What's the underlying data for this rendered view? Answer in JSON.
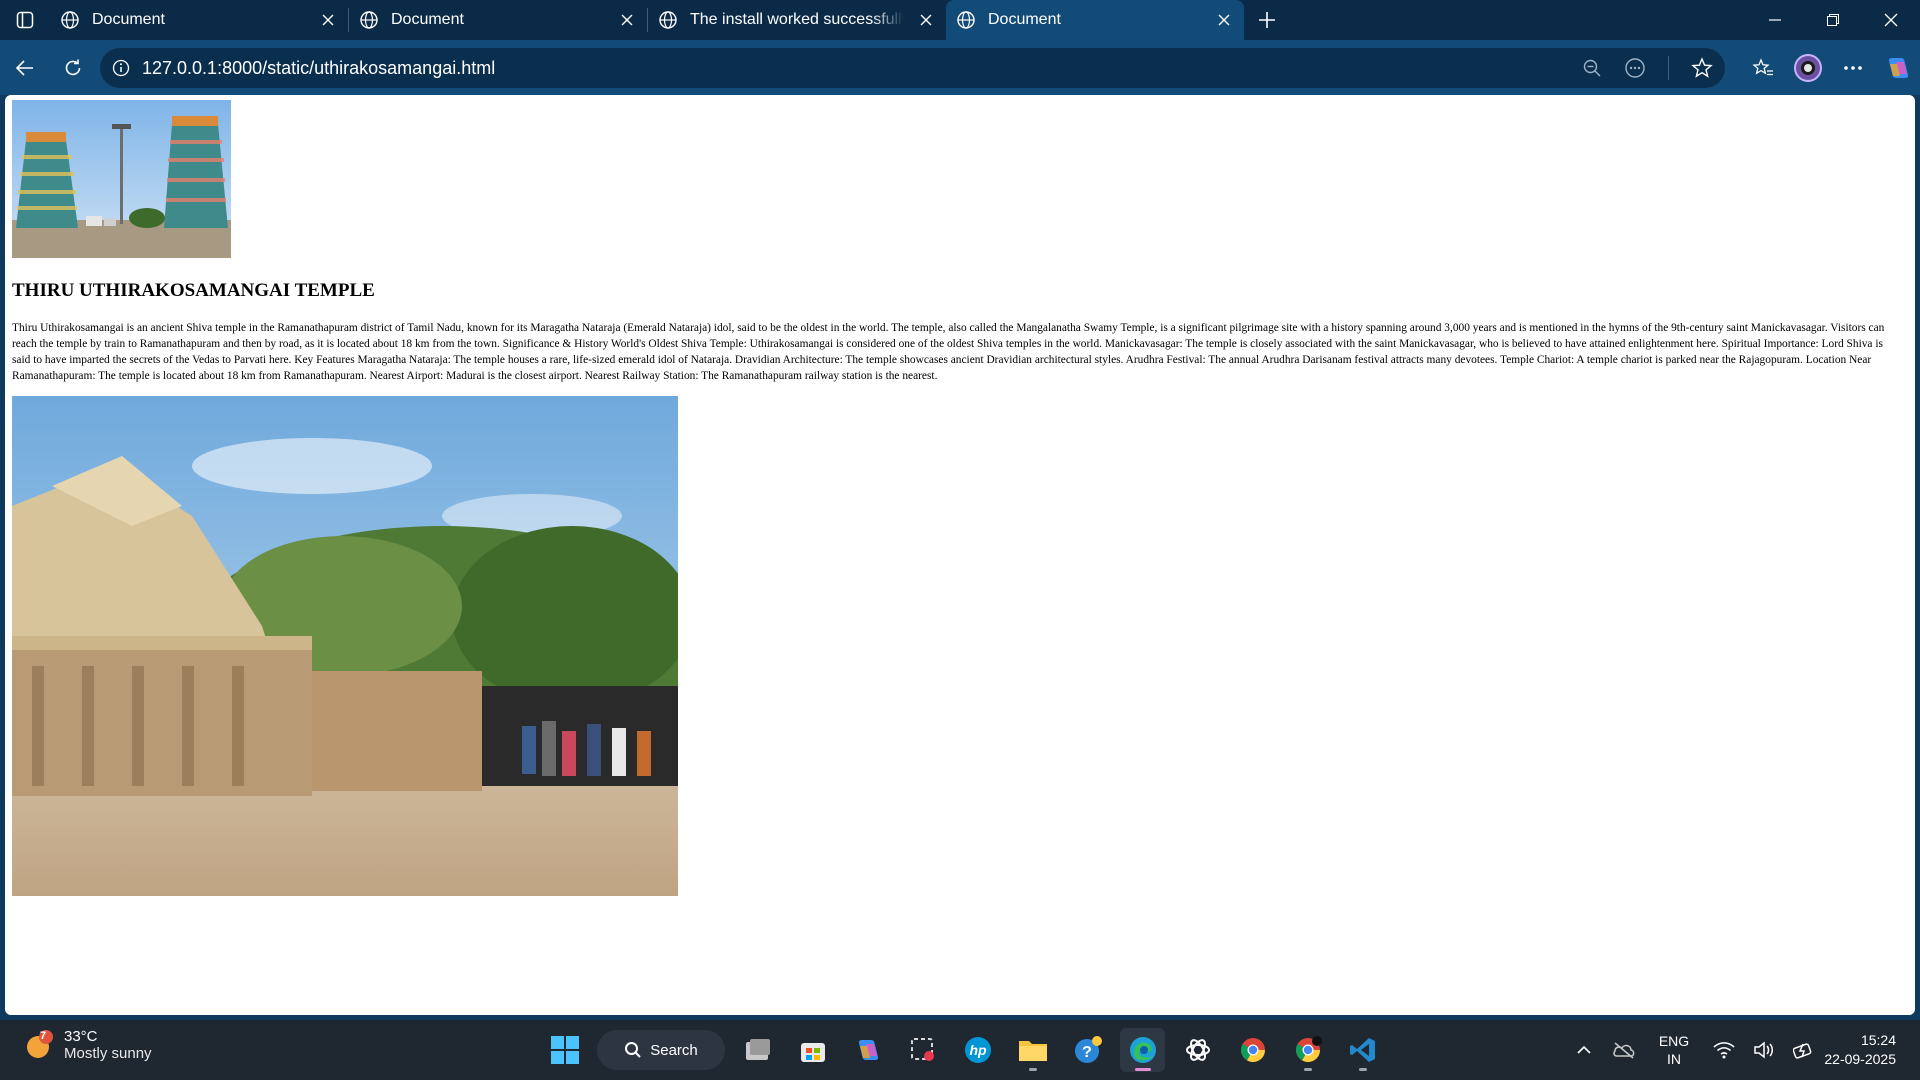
{
  "browser": {
    "tabs": [
      {
        "title": "Document",
        "active": false
      },
      {
        "title": "Document",
        "active": false
      },
      {
        "title": "The install worked successfully! Co",
        "active": false
      },
      {
        "title": "Document",
        "active": true
      }
    ],
    "url": "127.0.0.1:8000/static/uthirakosamangai.html"
  },
  "page": {
    "image1_alt": "temple gopurams",
    "title": "THIRU UTHIRAKOSAMANGAI TEMPLE",
    "paragraph": "Thiru Uthirakosamangai is an ancient Shiva temple in the Ramanathapuram district of Tamil Nadu, known for its Maragatha Nataraja (Emerald Nataraja) idol, said to be the oldest in the world. The temple, also called the Mangalanatha Swamy Temple, is a significant pilgrimage site with a history spanning around 3,000 years and is mentioned in the hymns of the 9th-century saint Manickavasagar. Visitors can reach the temple by train to Ramanathapuram and then by road, as it is located about 18 km from the town. Significance & History World's Oldest Shiva Temple: Uthirakosamangai is considered one of the oldest Shiva temples in the world. Manickavasagar: The temple is closely associated with the saint Manickavasagar, who is believed to have attained enlightenment here. Spiritual Importance: Lord Shiva is said to have imparted the secrets of the Vedas to Parvati here. Key Features Maragatha Nataraja: The temple houses a rare, life-sized emerald idol of Nataraja. Dravidian Architecture: The temple showcases ancient Dravidian architectural styles. Arudhra Festival: The annual Arudhra Darisanam festival attracts many devotees. Temple Chariot: A temple chariot is parked near the Rajagopuram. Location Near Ramanathapuram: The temple is located about 18 km from Ramanathapuram. Nearest Airport: Madurai is the closest airport. Nearest Railway Station: The Ramanathapuram railway station is the nearest.",
    "image2_alt": "temple vimana with devotees"
  },
  "taskbar": {
    "weather_temp": "33°C",
    "weather_cond": "Mostly sunny",
    "weather_badge": "7",
    "search_label": "Search",
    "lang_line1": "ENG",
    "lang_line2": "IN",
    "time": "15:24",
    "date": "22-09-2025"
  },
  "colors": {
    "tabstrip": "#0b2a47",
    "toolbar": "#124a78",
    "taskbar": "#1f2731"
  }
}
